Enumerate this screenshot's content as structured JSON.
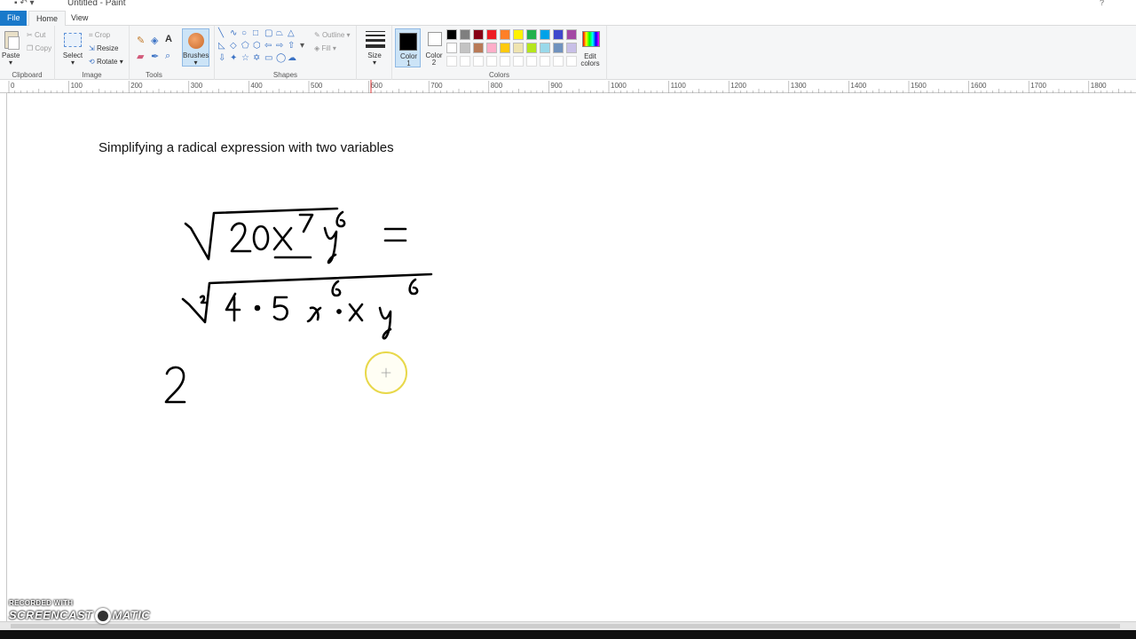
{
  "window": {
    "title": "Untitled - Paint",
    "quick_access": "▪ ↶ ▾",
    "help_icon": "?"
  },
  "tabs": [
    {
      "label": "File"
    },
    {
      "label": "Home"
    },
    {
      "label": "View"
    }
  ],
  "ribbon": {
    "clipboard": {
      "label": "Clipboard",
      "paste": "Paste",
      "cut": "Cut",
      "copy": "Copy"
    },
    "image": {
      "label": "Image",
      "select": "Select",
      "crop": "Crop",
      "resize": "Resize",
      "rotate": "Rotate"
    },
    "tools": {
      "label": "Tools",
      "brushes": "Brushes"
    },
    "shapes": {
      "label": "Shapes",
      "outline": "Outline",
      "fill": "Fill"
    },
    "size": {
      "label": "Size"
    },
    "colors": {
      "label": "Colors",
      "color1": "Color",
      "color1_num": "1",
      "color2": "Color",
      "color2_num": "2",
      "edit": "Edit",
      "edit2": "colors",
      "palette_row1": [
        "#000000",
        "#7f7f7f",
        "#880015",
        "#ed1c24",
        "#ff7f27",
        "#fff200",
        "#22b14c",
        "#00a2e8",
        "#3f48cc",
        "#a349a4"
      ],
      "palette_row2": [
        "#ffffff",
        "#c3c3c3",
        "#b97a57",
        "#ffaec9",
        "#ffc90e",
        "#efe4b0",
        "#b5e61d",
        "#99d9ea",
        "#7092be",
        "#c8bfe7"
      ]
    }
  },
  "ruler": {
    "labels": [
      "0",
      "100",
      "200",
      "300",
      "400",
      "500",
      "600",
      "700",
      "800",
      "900",
      "1000",
      "1100",
      "1200",
      "1300",
      "1400",
      "1500",
      "1600",
      "1700",
      "1800"
    ]
  },
  "canvas": {
    "title_text": "Simplifying a radical expression with two variables"
  },
  "watermark": {
    "recorded": "RECORDED WITH",
    "brand_left": "SCREENCAST",
    "brand_right": "MATIC"
  }
}
